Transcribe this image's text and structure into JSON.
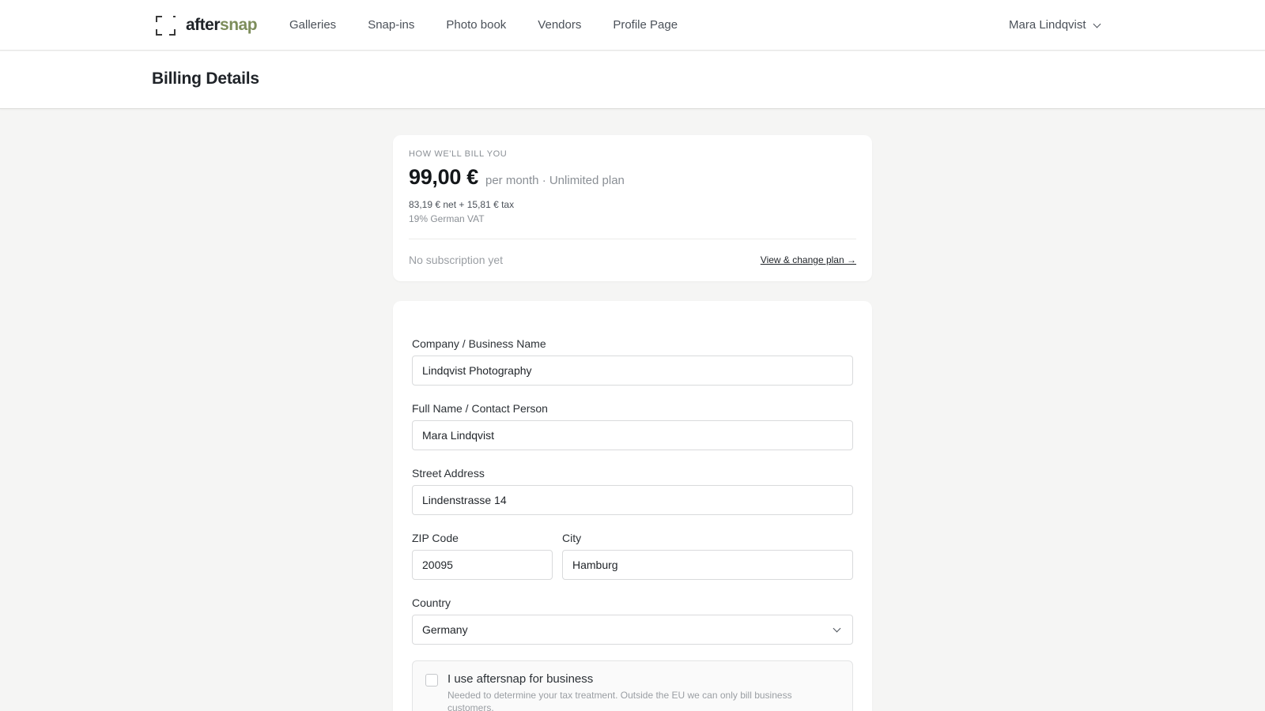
{
  "brand": {
    "name_part1": "after",
    "name_part2": "snap",
    "icon": "focus-frame-icon"
  },
  "nav": {
    "items": [
      {
        "label": "Galleries"
      },
      {
        "label": "Snap-ins"
      },
      {
        "label": "Photo book"
      },
      {
        "label": "Vendors"
      },
      {
        "label": "Profile Page"
      }
    ],
    "user_name": "Mara Lindqvist"
  },
  "page": {
    "title": "Billing Details"
  },
  "billing": {
    "eyebrow": "HOW WE'LL BILL YOU",
    "price": "99,00 €",
    "period_plan": "per month · Unlimited plan",
    "net_tax": "83,19 € net + 15,81 € tax",
    "vat_note": "19% German VAT",
    "subscription_status": "No subscription yet",
    "plan_link": "View & change plan →"
  },
  "form": {
    "company": {
      "label": "Company / Business Name",
      "value": "Lindqvist Photography"
    },
    "full_name": {
      "label": "Full Name / Contact Person",
      "value": "Mara Lindqvist"
    },
    "street": {
      "label": "Street Address",
      "value": "Lindenstrasse 14"
    },
    "zip": {
      "label": "ZIP Code",
      "value": "20095"
    },
    "city": {
      "label": "City",
      "value": "Hamburg"
    },
    "country": {
      "label": "Country",
      "value": "Germany"
    },
    "business": {
      "title": "I use aftersnap for business",
      "help": "Needed to determine your tax treatment. Outside the EU we can only bill business customers."
    }
  },
  "colors": {
    "accent": "#7d8d5b",
    "background": "#f5f5f4",
    "text": "#1f2328"
  }
}
